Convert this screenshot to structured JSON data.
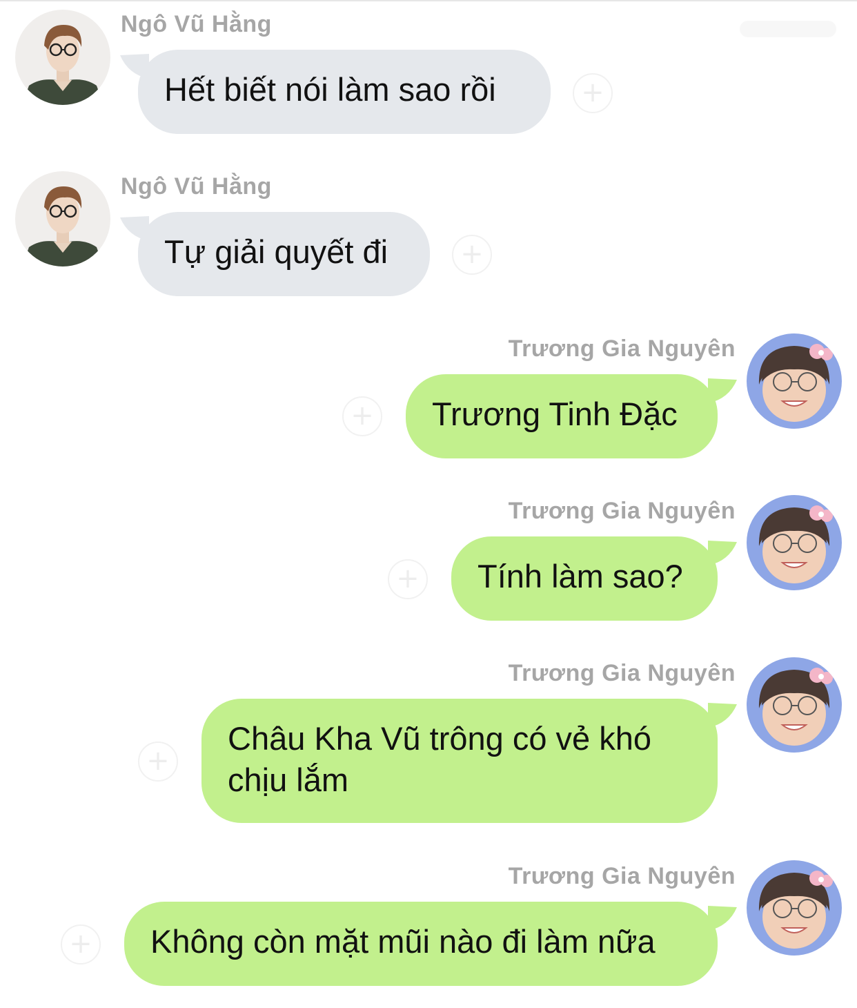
{
  "messages": [
    {
      "sender": "Ngô Vũ Hằng",
      "text": "Hết biết nói làm sao rồi",
      "direction": "incoming",
      "avatar": "avatar-ngo-vu-hang"
    },
    {
      "sender": "Ngô Vũ Hằng",
      "text": "Tự giải quyết đi",
      "direction": "incoming",
      "avatar": "avatar-ngo-vu-hang"
    },
    {
      "sender": "Trương Gia Nguyên",
      "text": "Trương Tinh Đặc",
      "direction": "outgoing",
      "avatar": "avatar-truong-gia-nguyen"
    },
    {
      "sender": "Trương Gia Nguyên",
      "text": "Tính làm sao?",
      "direction": "outgoing",
      "avatar": "avatar-truong-gia-nguyen"
    },
    {
      "sender": "Trương Gia Nguyên",
      "text_lines": [
        "Châu Kha Vũ trông có vẻ khó",
        "chịu lắm"
      ],
      "direction": "outgoing",
      "avatar": "avatar-truong-gia-nguyen"
    },
    {
      "sender": "Trương Gia Nguyên",
      "text": "Không còn mặt mũi nào đi làm nữa",
      "direction": "outgoing",
      "avatar": "avatar-truong-gia-nguyen"
    }
  ],
  "react_icon": "add-reaction-icon",
  "colors": {
    "incoming_bubble": "#e5e8ec",
    "outgoing_bubble": "#c2f08d",
    "sender_name": "#a6a6a6",
    "message_text": "#111111"
  }
}
